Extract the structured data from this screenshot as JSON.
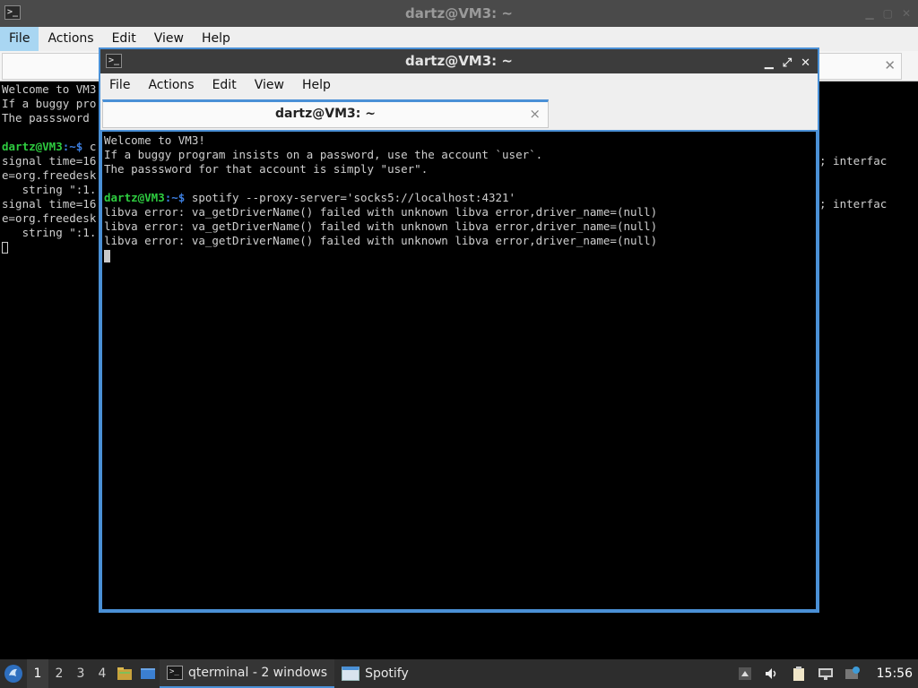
{
  "back_window": {
    "title": "dartz@VM3: ~",
    "menu": [
      "File",
      "Actions",
      "Edit",
      "View",
      "Help"
    ],
    "terminal_lines_left": [
      "Welcome to VM3",
      "If a buggy pro",
      "The passsword",
      "",
      "signal time=16",
      "e=org.freedesk",
      "   string \":1.",
      "signal time=16",
      "e=org.freedesk",
      "   string \":1."
    ],
    "prompt_user": "dartz@VM3",
    "prompt_path": ":~$ ",
    "prompt_partial": "c",
    "terminal_lines_right": [
      "; interfac",
      "",
      "",
      "; interfac"
    ]
  },
  "front_window": {
    "title": "dartz@VM3: ~",
    "menu": [
      "File",
      "Actions",
      "Edit",
      "View",
      "Help"
    ],
    "tab_title": "dartz@VM3: ~",
    "tab_close": "×",
    "terminal": {
      "intro": [
        "Welcome to VM3!",
        "If a buggy program insists on a password, use the account `user`.",
        "The passsword for that account is simply \"user\"."
      ],
      "prompt_user": "dartz@VM3",
      "prompt_path": ":~$ ",
      "command": "spotify --proxy-server='socks5://localhost:4321'",
      "errors": [
        "libva error: va_getDriverName() failed with unknown libva error,driver_name=(null)",
        "libva error: va_getDriverName() failed with unknown libva error,driver_name=(null)",
        "libva error: va_getDriverName() failed with unknown libva error,driver_name=(null)"
      ]
    }
  },
  "taskbar": {
    "workspaces": [
      "1",
      "2",
      "3",
      "4"
    ],
    "active_workspace": "1",
    "tasks": [
      {
        "label": "qterminal - 2 windows",
        "icon": "terminal-icon"
      },
      {
        "label": "Spotify",
        "icon": "window-icon"
      }
    ],
    "clock": "15:56"
  },
  "colors": {
    "accent": "#4a90d6",
    "prompt_user": "#2ecc40",
    "prompt_path": "#3d7fe0",
    "terminal_bg": "#000000",
    "taskbar_bg": "#2d2d2d"
  }
}
